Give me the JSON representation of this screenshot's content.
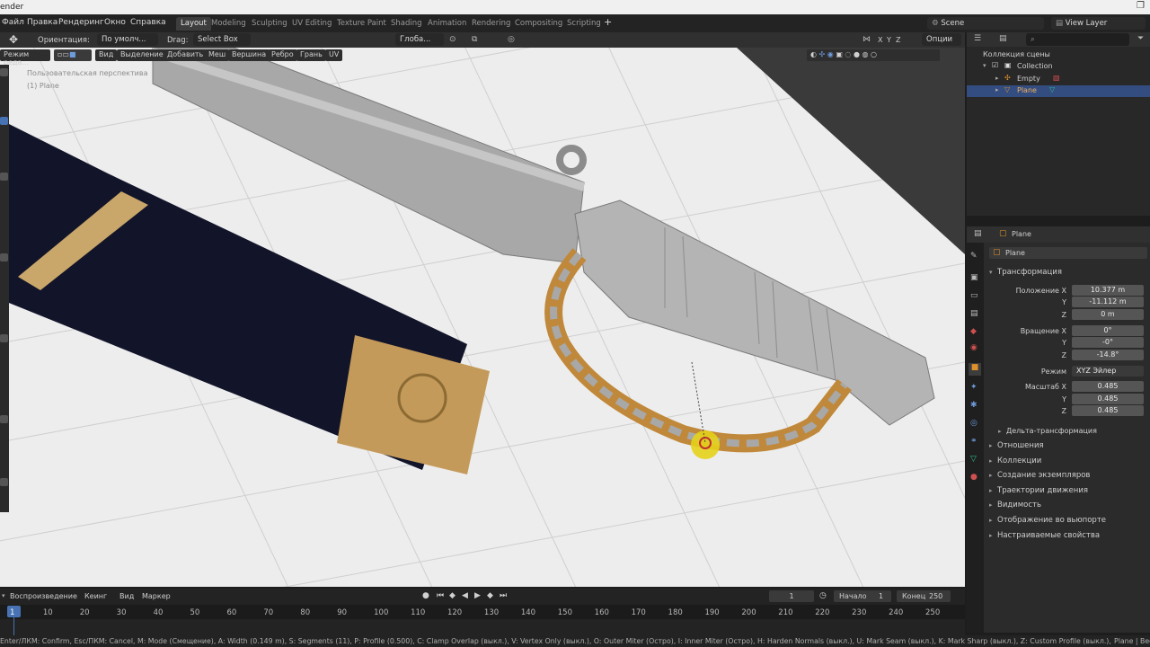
{
  "titlebar": {
    "title": "ender"
  },
  "menu": [
    "Файл",
    "Правка",
    "Рендеринг",
    "Окно",
    "Справка"
  ],
  "workspaces": [
    {
      "label": "Layout",
      "active": true
    },
    {
      "label": "Modeling"
    },
    {
      "label": "Sculpting"
    },
    {
      "label": "UV Editing"
    },
    {
      "label": "Texture Paint"
    },
    {
      "label": "Shading"
    },
    {
      "label": "Animation"
    },
    {
      "label": "Rendering"
    },
    {
      "label": "Compositing"
    },
    {
      "label": "Scripting"
    }
  ],
  "add_workspace": "+",
  "scene": {
    "label": "Scene",
    "view_layer": "View Layer"
  },
  "toolheader": {
    "orientation_label": "Ориентация:",
    "orientation_value": "По умолч...",
    "drag_label": "Drag:",
    "drag_value": "Select Box",
    "transform": "Глоба...",
    "options": "Опции"
  },
  "viewport": {
    "mode": "Режим реда...",
    "menus": [
      "Вид",
      "Выделение",
      "Добавить",
      "Меш",
      "Вершина",
      "Ребро",
      "Грань",
      "UV"
    ],
    "perspective": "Пользовательская перспектива",
    "object_label": "(1) Plane",
    "axes": [
      "X",
      "Y",
      "Z"
    ]
  },
  "outliner": {
    "search_placeholder": "",
    "root": "Коллекция сцены",
    "collection": "Collection",
    "items": [
      {
        "label": "Empty"
      },
      {
        "label": "Plane",
        "selected": true
      }
    ]
  },
  "properties": {
    "object": "Plane",
    "object_field": "Plane",
    "transform_title": "Трансформация",
    "location": {
      "label": "Положение X",
      "x": "10.377 m",
      "y_label": "Y",
      "y": "-11.112 m",
      "z_label": "Z",
      "z": "0 m"
    },
    "rotation": {
      "label": "Вращение X",
      "x": "0°",
      "y_label": "Y",
      "y": "-0°",
      "z_label": "Z",
      "z": "-14.8°"
    },
    "mode_label": "Режим",
    "mode_value": "XYZ Эйлер",
    "scale": {
      "label": "Масштаб X",
      "x": "0.485",
      "y_label": "Y",
      "y": "0.485",
      "z_label": "Z",
      "z": "0.485"
    },
    "delta": "Дельта-трансформация",
    "sections": [
      "Отношения",
      "Коллекции",
      "Создание экземпляров",
      "Траектории движения",
      "Видимость",
      "Отображение во вьюпорте",
      "Настраиваемые свойства"
    ]
  },
  "timeline": {
    "menus": [
      "Воспроизведение",
      "Кеинг",
      "Вид",
      "Маркер"
    ],
    "current_frame": "1",
    "start_label": "Начало",
    "start": "1",
    "end_label": "Конец",
    "end": "250",
    "ticks": [
      "1",
      "10",
      "20",
      "30",
      "40",
      "50",
      "60",
      "70",
      "80",
      "90",
      "100",
      "110",
      "120",
      "130",
      "140",
      "150",
      "160",
      "170",
      "180",
      "190",
      "200",
      "210",
      "220",
      "230",
      "240",
      "250"
    ]
  },
  "status": {
    "text": "Enter/ЛКМ: Confirm, Esc/ПКМ: Cancel, M: Mode (Смещение), A: Width (0.149 m), S: Segments (11), P: Profile (0.500), C: Clamp Overlap (выкл.), V: Vertex Only (выкл.), O: Outer Miter (Остро), I: Inner Miter (Остро), H: Harden Normals (выкл.), U: Mark Seam (выкл.), K: Mark Sharp (выкл.), Z: Custom Profile (выкл.), N: Intersection (Grid Fill)",
    "right": "Plane | Beg"
  },
  "colors": {
    "accent": "#4772b3",
    "selected_row": "#334d80",
    "orange": "#e0902a",
    "viewport_bg": "#ededed"
  }
}
